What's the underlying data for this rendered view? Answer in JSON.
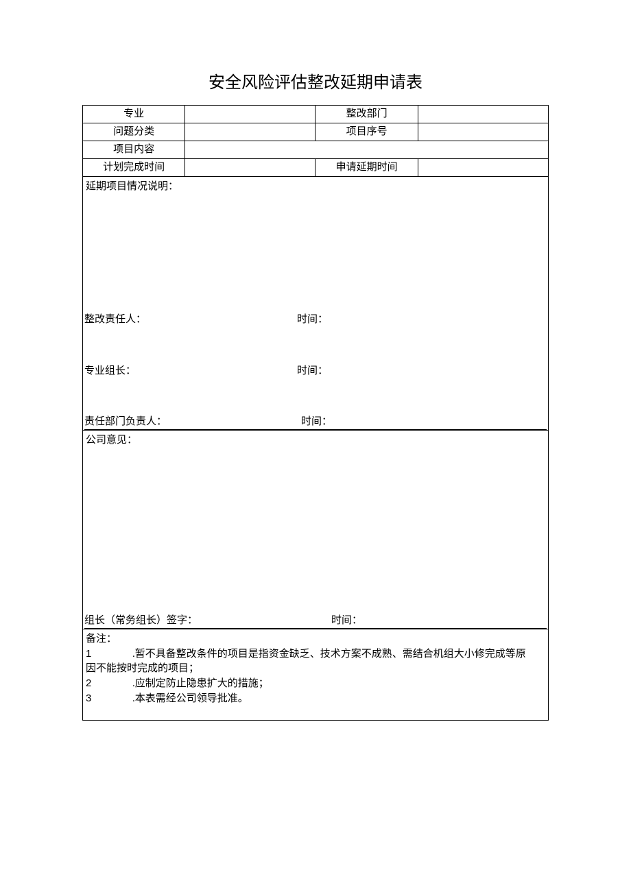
{
  "title": "安全风险评估整改延期申请表",
  "labels": {
    "specialty": "专业",
    "dept": "整改部门",
    "problem_type": "问题分类",
    "project_no": "项目序号",
    "project_content": "项目内容",
    "plan_time": "计划完成时间",
    "extend_time": "申请延期时间"
  },
  "values": {
    "specialty": "",
    "dept": "",
    "problem_type": "",
    "project_no": "",
    "project_content": "",
    "plan_time": "",
    "extend_time": ""
  },
  "section1": {
    "header": "延期项目情况说明：",
    "responsible_label": "整改责任人：",
    "responsible_value": "",
    "team_leader_label": "专业组长：",
    "team_leader_value": "",
    "dept_head_label": "责任部门负责人：",
    "dept_head_value": "",
    "time_label": "时间：",
    "time1": "",
    "time2": "",
    "time3": ""
  },
  "section2": {
    "header": "公司意见：",
    "sign_label": "组长（常务组长）签字：",
    "sign_value": "",
    "time_label": "时间：",
    "time_value": ""
  },
  "notes": {
    "header": "备注：",
    "items": [
      {
        "n": "1",
        "text": ".暂不具备整改条件的项目是指资金缺乏、技术方案不成熟、需结合机组大小修完成等原"
      },
      {
        "n": "",
        "text_cont": "因不能按时完成的项目；"
      },
      {
        "n": "2",
        "text": ".应制定防止隐患扩大的措施；"
      },
      {
        "n": "3",
        "text": ".本表需经公司领导批准。"
      }
    ]
  }
}
